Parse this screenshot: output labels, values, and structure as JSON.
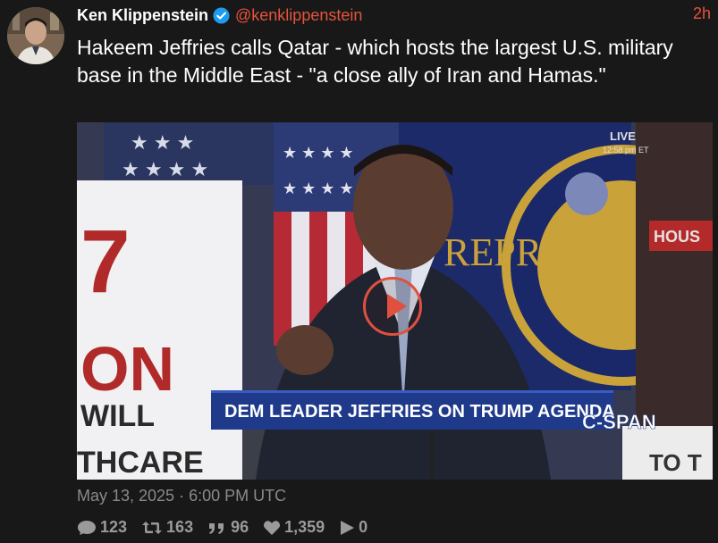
{
  "author": {
    "name": "Ken Klippenstein",
    "handle": "@kenklippenstein",
    "time": "2h"
  },
  "tweet": {
    "text": "Hakeem Jeffries calls Qatar - which hosts the largest U.S. military base in the Middle East - \"a close ally of Iran and Hamas.\"",
    "date": "May 13, 2025 · 6:00 PM UTC"
  },
  "video": {
    "live_label": "LIVE",
    "live_time": "12:58 pm ET",
    "chyron": "DEM LEADER JEFFRIES ON TRUMP AGENDA",
    "network": "C-SPAN",
    "sign_left": [
      "7",
      "ON",
      "WILL",
      "THCARE"
    ],
    "sign_right": "HOUS",
    "sign_right_bottom": "T",
    "sign_right_bottom2": "TO T",
    "seal_text": "REPRESE"
  },
  "stats": {
    "replies": "123",
    "retweets": "163",
    "quotes": "96",
    "likes": "1,359",
    "views": "0"
  },
  "colors": {
    "accent": "#e5533d",
    "background": "#181818",
    "chyron_bg": "#1f3a8a"
  }
}
